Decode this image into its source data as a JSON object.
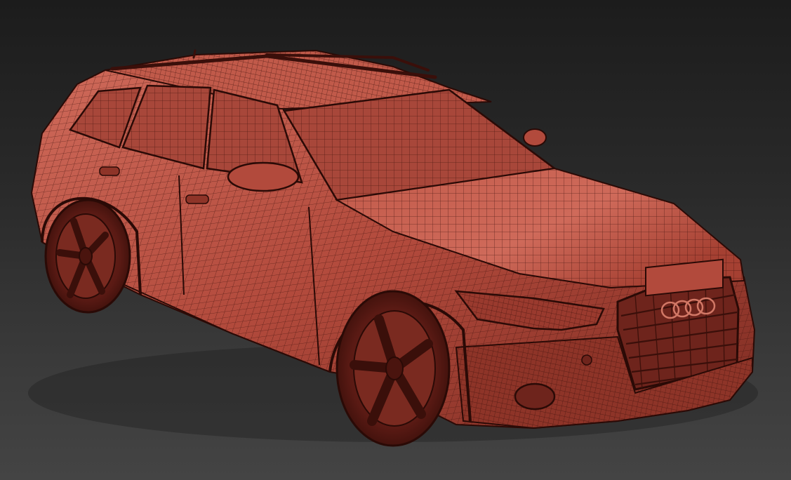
{
  "viewport": {
    "render_mode": "wireframe-on-shaded",
    "background_top": "#1c1c1c",
    "background_bottom": "#444444"
  },
  "model": {
    "subject": "station-wagon-car",
    "shade_color": "#b24a3c",
    "shade_highlight": "#cf6a5a",
    "shade_dark": "#6e241c",
    "wire_color": "#3a0f0a",
    "wheel_color": "#5a1a14",
    "glass_color": "#a8473a"
  },
  "grille_emblem": {
    "icon": "four-rings-emblem",
    "ring_count": 4
  }
}
